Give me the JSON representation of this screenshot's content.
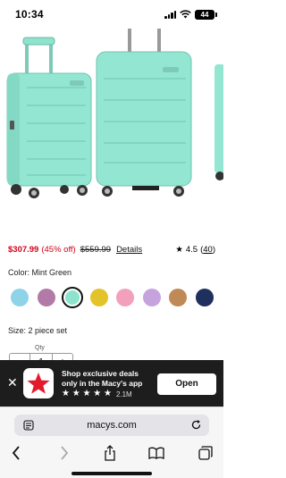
{
  "status_bar": {
    "time": "10:34",
    "battery": "44",
    "icons": [
      "cellular-signal-icon",
      "wifi-icon",
      "battery-icon"
    ]
  },
  "product": {
    "image_alt": "two mint green hardside spinner suitcases",
    "sale_price": "$307.99",
    "percent_off": "(45% off)",
    "original_price": "$559.99",
    "details_link": "Details",
    "rating_value": "4.5",
    "review_count": "40",
    "color_label": "Color: Mint Green",
    "swatches": [
      {
        "name": "light-blue",
        "hex": "#8fd3e8"
      },
      {
        "name": "mauve",
        "hex": "#b27aa6"
      },
      {
        "name": "mint-green",
        "hex": "#8ee3cd",
        "selected": true
      },
      {
        "name": "yellow",
        "hex": "#e2c42a"
      },
      {
        "name": "pink",
        "hex": "#f2a0bc"
      },
      {
        "name": "lavender",
        "hex": "#c7a3dd"
      },
      {
        "name": "tan",
        "hex": "#c08a57"
      },
      {
        "name": "navy",
        "hex": "#1f2f5e"
      }
    ],
    "size_label": "Size: 2 piece set",
    "qty_label": "Qty",
    "qty_value": "1",
    "qty_minus": "−",
    "qty_plus": "+"
  },
  "app_banner": {
    "line1": "Shop exclusive deals",
    "line2": "only in the Macy's app",
    "stars": "★ ★ ★ ★ ★",
    "rating_count": "2.1M",
    "open_label": "Open",
    "accent_color": "#e21a2c"
  },
  "browser": {
    "url": "macys.com"
  }
}
